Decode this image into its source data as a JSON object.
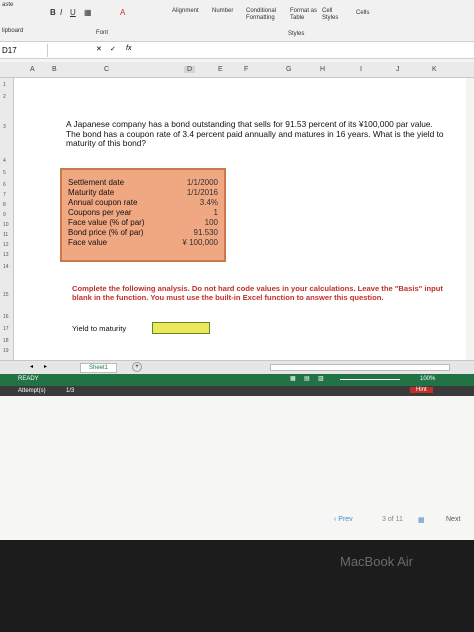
{
  "ribbon": {
    "paste": "aste",
    "clipboard": "lipboard",
    "font_group": "Font",
    "alignment": "Alignment",
    "number": "Number",
    "conditional_formatting": "Conditional Formatting",
    "format_as_table": "Format as Table",
    "cell_styles": "Cell Styles",
    "cells": "Cells",
    "styles_group": "Styles"
  },
  "formula_bar": {
    "name_box": "D17",
    "fx": "fx"
  },
  "columns": [
    "A",
    "B",
    "C",
    "D",
    "E",
    "F",
    "G",
    "H",
    "I",
    "J",
    "K"
  ],
  "rows": [
    "1",
    "2",
    "3",
    "4",
    "5",
    "6",
    "7",
    "8",
    "9",
    "10",
    "11",
    "12",
    "13",
    "14",
    "15",
    "16",
    "17",
    "18",
    "19"
  ],
  "question": "A Japanese company has a bond outstanding that sells for 91.53 percent of its ¥100,000 par value. The bond has a coupon rate of 3.4 percent paid annually and matures in 16 years. What is the yield to maturity of this bond?",
  "inputs": [
    {
      "label": "Settlement date",
      "value": "1/1/2000"
    },
    {
      "label": "Maturity date",
      "value": "1/1/2016"
    },
    {
      "label": "Annual coupon rate",
      "value": "3.4%"
    },
    {
      "label": "Coupons per year",
      "value": "1"
    },
    {
      "label": "Face value (% of par)",
      "value": "100"
    },
    {
      "label": "Bond price (% of par)",
      "value": "91.530"
    },
    {
      "label": "Face value",
      "value": "¥ 100,000"
    }
  ],
  "instructions": "Complete the following analysis. Do not hard code values in your calculations. Leave the \"Basis\" input blank in the function. You must use the built-in Excel function to answer this question.",
  "ytm_label": "Yield to maturity",
  "sheet_tab": "Sheet1",
  "status": {
    "ready": "READY",
    "attempts": "Attempt(s)",
    "attempts_val": "1/3",
    "zoom": "100%",
    "hint": "Hint"
  },
  "lms": {
    "prev": "Prev",
    "page": "3 of 11",
    "next": "Next"
  },
  "laptop": "MacBook Air",
  "colors": {
    "excel_green": "#217346",
    "input_box": "#f0a882",
    "instruction_red": "#c0302a",
    "answer_cell": "#ece85a"
  }
}
